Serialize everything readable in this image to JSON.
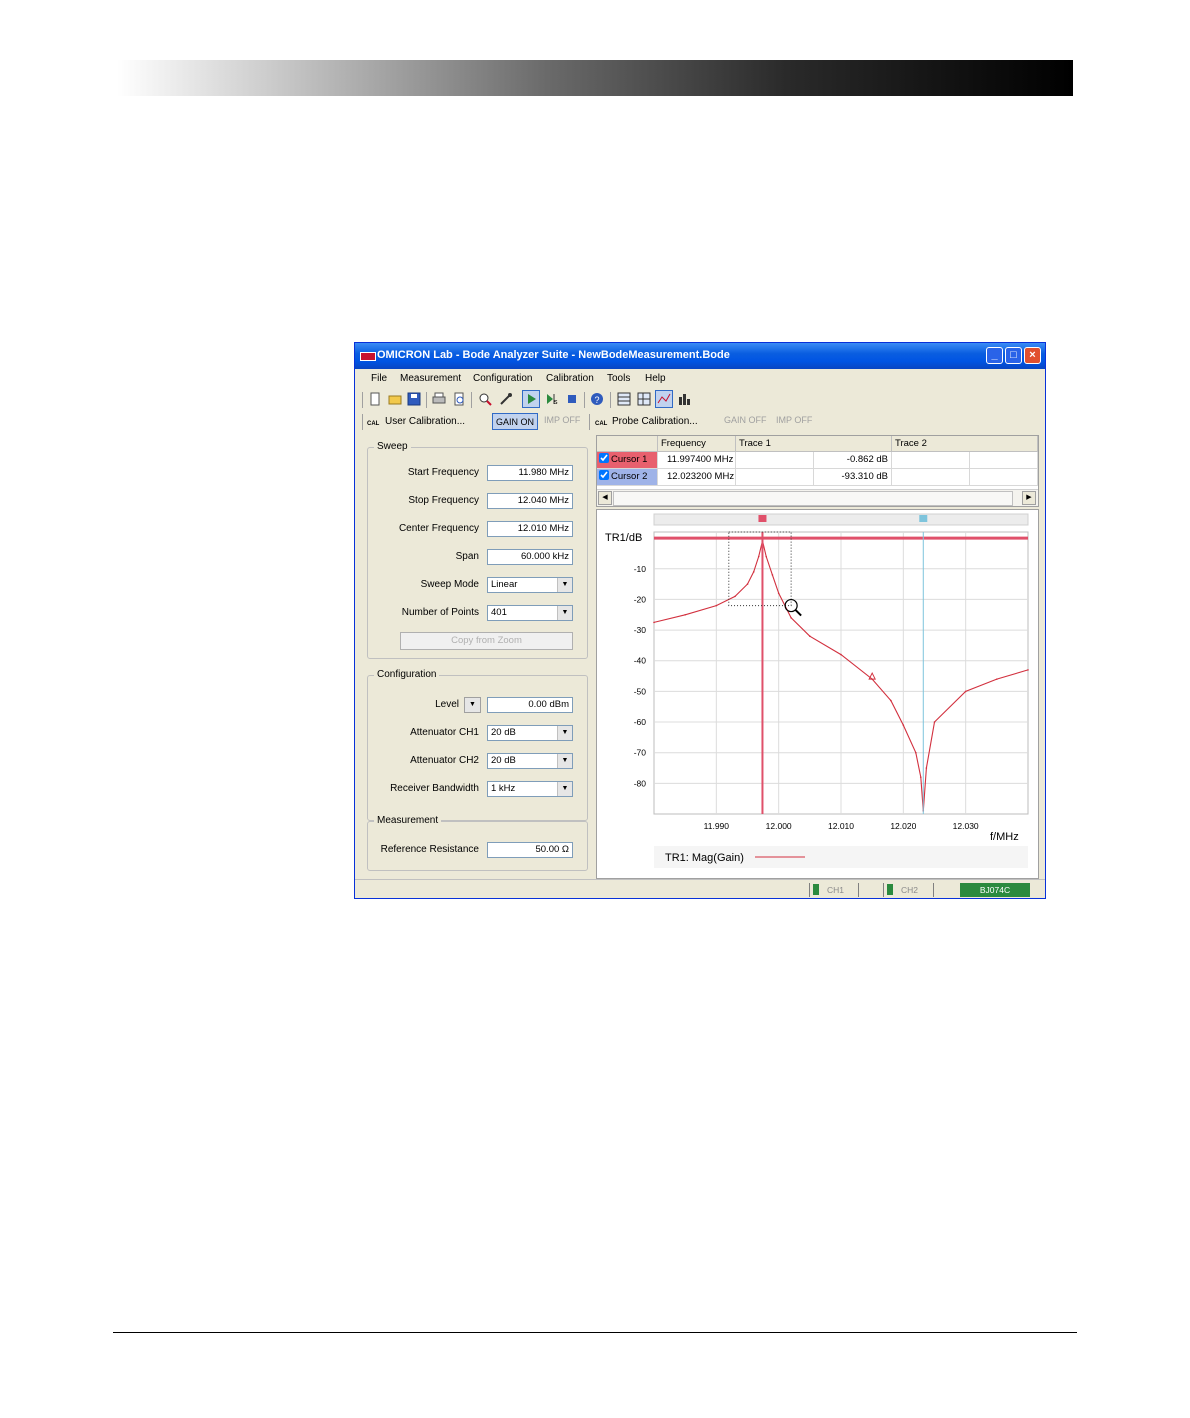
{
  "window": {
    "title": "OMICRON Lab - Bode Analyzer Suite - NewBodeMeasurement.Bode"
  },
  "menu": [
    "File",
    "Measurement",
    "Configuration",
    "Calibration",
    "Tools",
    "Help"
  ],
  "toolbar": {
    "icons": [
      "new-file-icon",
      "open-folder-icon",
      "save-icon",
      "print-icon",
      "print-preview-icon",
      "zoom-icon",
      "wrench-icon",
      "play-icon",
      "single-sweep-icon",
      "stop-icon",
      "help-icon",
      "grid-view-icon",
      "table-view-icon",
      "graph-view-icon",
      "bar-view-icon"
    ],
    "single_sweep_sub": "s"
  },
  "calibration_bar": {
    "cal_icon_text": "CAL",
    "user_calibration": "User Calibration...",
    "gain_on": "GAIN ON",
    "imp_off_1": "IMP OFF",
    "probe_calibration": "Probe Calibration...",
    "gain_off": "GAIN OFF",
    "imp_off_2": "IMP OFF"
  },
  "sweep": {
    "title": "Sweep",
    "start_frequency_label": "Start Frequency",
    "start_frequency": "11.980 MHz",
    "stop_frequency_label": "Stop Frequency",
    "stop_frequency": "12.040 MHz",
    "center_frequency_label": "Center Frequency",
    "center_frequency": "12.010 MHz",
    "span_label": "Span",
    "span": "60.000 kHz",
    "sweep_mode_label": "Sweep Mode",
    "sweep_mode": "Linear",
    "number_of_points_label": "Number of Points",
    "number_of_points": "401",
    "copy_from_zoom": "Copy from Zoom"
  },
  "configuration": {
    "title": "Configuration",
    "level_label": "Level",
    "level": "0.00 dBm",
    "attenuator_ch1_label": "Attenuator CH1",
    "attenuator_ch1": "20 dB",
    "attenuator_ch2_label": "Attenuator CH2",
    "attenuator_ch2": "20 dB",
    "receiver_bandwidth_label": "Receiver Bandwidth",
    "receiver_bandwidth": "1 kHz"
  },
  "measurement": {
    "title": "Measurement",
    "reference_resistance_label": "Reference Resistance",
    "reference_resistance": "50.00 Ω"
  },
  "cursor_table": {
    "headers": [
      "Frequency",
      "Trace 1",
      "Trace 2"
    ],
    "rows": [
      {
        "name": "Cursor 1",
        "frequency": "11.997400 MHz",
        "trace1": "-0.862 dB",
        "color": "#e8606e"
      },
      {
        "name": "Cursor 2",
        "frequency": "12.023200 MHz",
        "trace1": "-93.310 dB",
        "color": "#9fb3e8"
      }
    ]
  },
  "status_bar": {
    "ch1": "CH1",
    "ch2": "CH2",
    "device": "BJ074C"
  },
  "chart_data": {
    "type": "line",
    "ylabel": "TR1/dB",
    "xlabel": "f/MHz",
    "xlim": [
      11.98,
      12.04
    ],
    "ylim": [
      -90,
      2
    ],
    "x_ticks": [
      "11.990",
      "12.000",
      "12.010",
      "12.020",
      "12.030"
    ],
    "x_tick_values": [
      11.99,
      12.0,
      12.01,
      12.02,
      12.03
    ],
    "y_ticks": [
      "-10",
      "-20",
      "-30",
      "-40",
      "-50",
      "-60",
      "-70",
      "-80"
    ],
    "y_tick_values": [
      -10,
      -20,
      -30,
      -40,
      -50,
      -60,
      -70,
      -80
    ],
    "legend": "TR1: Mag(Gain)",
    "series": [
      {
        "color": "#d2303e",
        "x": [
          11.98,
          11.985,
          11.99,
          11.993,
          11.995,
          11.996,
          11.9968,
          11.9974,
          11.998,
          11.999,
          12.0,
          12.002,
          12.005,
          12.01,
          12.015,
          12.018,
          12.02,
          12.022,
          12.0228,
          12.0232,
          12.0237,
          12.025,
          12.03,
          12.035,
          12.04
        ],
        "y": [
          -27.5,
          -25,
          -22,
          -19,
          -15,
          -11,
          -6,
          -0.9,
          -6,
          -12,
          -18,
          -26,
          -32,
          -38,
          -46,
          -53,
          -61,
          -70,
          -78,
          -89,
          -75,
          -60,
          -50,
          -46,
          -43
        ]
      }
    ],
    "cursors": [
      {
        "label": "Cursor 1",
        "x": 11.9974,
        "color": "#e0506a"
      },
      {
        "label": "Cursor 2",
        "x": 12.0232,
        "color": "#7ec4dc"
      }
    ],
    "reference_line_y": 0,
    "zoom_box": {
      "x": [
        11.992,
        12.002
      ],
      "y": [
        -22,
        2
      ]
    },
    "grid": true
  }
}
